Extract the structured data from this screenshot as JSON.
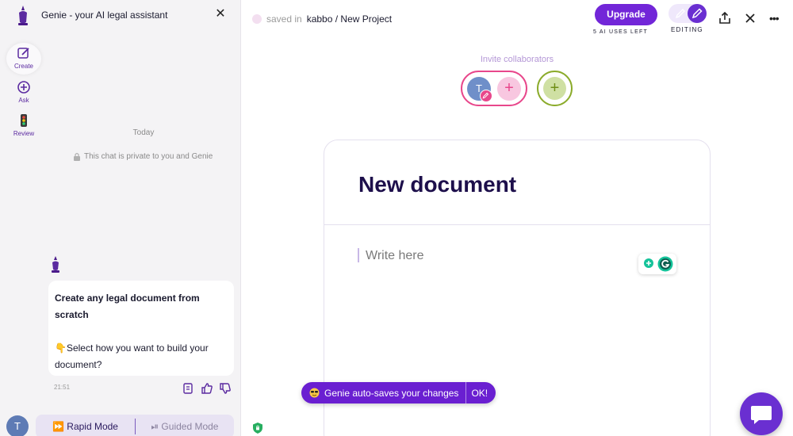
{
  "left_panel": {
    "header_title": "Genie - your AI legal assistant",
    "close_glyph": "✕",
    "rail": [
      {
        "label": "Create",
        "icon": "create-icon"
      },
      {
        "label": "Ask",
        "icon": "ask-icon"
      },
      {
        "label": "Review",
        "icon": "review-icon"
      }
    ],
    "chat": {
      "date_divider": "Today",
      "privacy_note": "This chat is private to you and Genie",
      "message_bold": "Create any legal document from scratch",
      "message_prompt": "👇Select how you want to build your document?",
      "time": "21:51",
      "actions": [
        "copy-icon",
        "thumbs-up-icon",
        "thumbs-down-icon"
      ]
    },
    "user_initial": "T",
    "modes": {
      "rapid": "⏩ Rapid Mode",
      "guided": "⏯ Guided Mode"
    }
  },
  "topbar": {
    "saved_label": "saved in",
    "path": "kabbo / New Project",
    "upgrade_label": "Upgrade",
    "uses_left": "5 AI USES LEFT",
    "editing_label": "EDITING",
    "more_glyph": "•••"
  },
  "invite": {
    "label": "Invite collaborators",
    "collaborator_initial": "T",
    "add_glyph": "+"
  },
  "document": {
    "title": "New document",
    "placeholder": "Write here"
  },
  "toast": {
    "message": "Genie auto-saves your changes",
    "ok_label": "OK!"
  },
  "colors": {
    "brand_purple": "#6a1fd1",
    "upgrade_purple": "#7226d8",
    "collab_pink": "#e8478b",
    "collab_green": "#8bab2b"
  }
}
